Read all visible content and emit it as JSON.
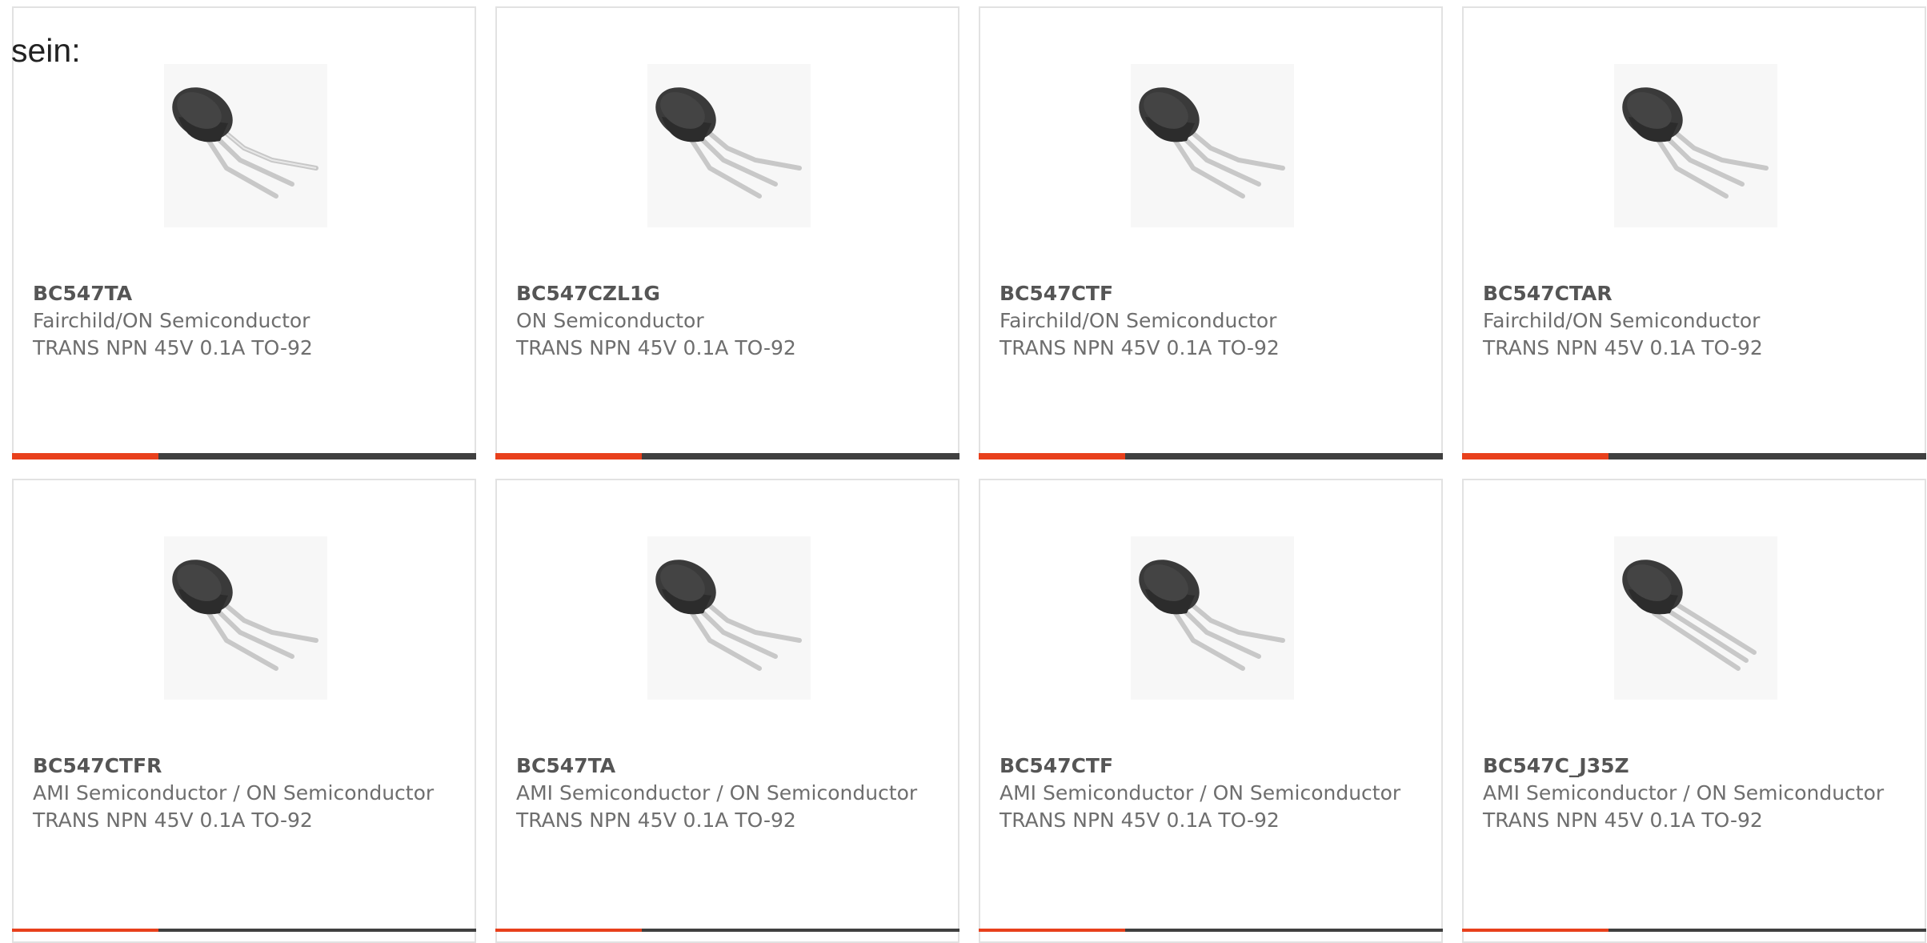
{
  "intro_text": "sein:",
  "accent_color": "#e8401c",
  "image_icon": "transistor-to92-icon",
  "cards": [
    {
      "part": "BC547TA",
      "manufacturer": "Fairchild/ON Semiconductor",
      "description": "TRANS NPN 45V 0.1A TO-92"
    },
    {
      "part": "BC547CZL1G",
      "manufacturer": "ON Semiconductor",
      "description": "TRANS NPN 45V 0.1A TO-92"
    },
    {
      "part": "BC547CTF",
      "manufacturer": "Fairchild/ON Semiconductor",
      "description": "TRANS NPN 45V 0.1A TO-92"
    },
    {
      "part": "BC547CTAR",
      "manufacturer": "Fairchild/ON Semiconductor",
      "description": "TRANS NPN 45V 0.1A TO-92"
    },
    {
      "part": "BC547CTFR",
      "manufacturer": "AMI Semiconductor / ON Semiconductor",
      "description": "TRANS NPN 45V 0.1A TO-92"
    },
    {
      "part": "BC547TA",
      "manufacturer": "AMI Semiconductor / ON Semiconductor",
      "description": "TRANS NPN 45V 0.1A TO-92"
    },
    {
      "part": "BC547CTF",
      "manufacturer": "AMI Semiconductor / ON Semiconductor",
      "description": "TRANS NPN 45V 0.1A TO-92"
    },
    {
      "part": "BC547C_J35Z",
      "manufacturer": "AMI Semiconductor / ON Semiconductor",
      "description": "TRANS NPN 45V 0.1A TO-92"
    }
  ]
}
